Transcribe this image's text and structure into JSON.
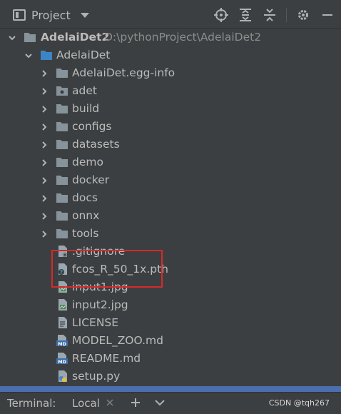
{
  "toolbar": {
    "title": "Project",
    "icons": [
      "locate-icon",
      "expand-all-icon",
      "collapse-all-icon",
      "gear-icon",
      "minimize-icon"
    ]
  },
  "tree": {
    "root": {
      "label": "AdelaiDet2",
      "path": "D:\\pythonProject\\AdelaiDet2"
    },
    "module": {
      "label": "AdelaiDet"
    },
    "folders": [
      "AdelaiDet.egg-info",
      "adet",
      "build",
      "configs",
      "datasets",
      "demo",
      "docker",
      "docs",
      "onnx",
      "tools"
    ],
    "files": [
      {
        "label": ".gitignore",
        "icon": "gitignore-file-icon"
      },
      {
        "label": "fcos_R_50_1x.pth",
        "icon": "unknown-file-icon"
      },
      {
        "label": "input1.jpg",
        "icon": "image-file-icon"
      },
      {
        "label": "input2.jpg",
        "icon": "image-file-icon"
      },
      {
        "label": "LICENSE",
        "icon": "text-file-icon"
      },
      {
        "label": "MODEL_ZOO.md",
        "icon": "markdown-file-icon"
      },
      {
        "label": "README.md",
        "icon": "markdown-file-icon"
      },
      {
        "label": "setup.py",
        "icon": "python-file-icon"
      }
    ]
  },
  "bottom_bar": {
    "terminal_label": "Terminal:",
    "tab_label": "Local",
    "watermark": "CSDN @tqh267"
  },
  "colors": {
    "background": "#3c3f41",
    "text": "#bbbbbb",
    "folder": "#87939a",
    "module_folder": "#3d84c6",
    "highlight": "#d62a2a",
    "selection": "#4b6eaf"
  }
}
